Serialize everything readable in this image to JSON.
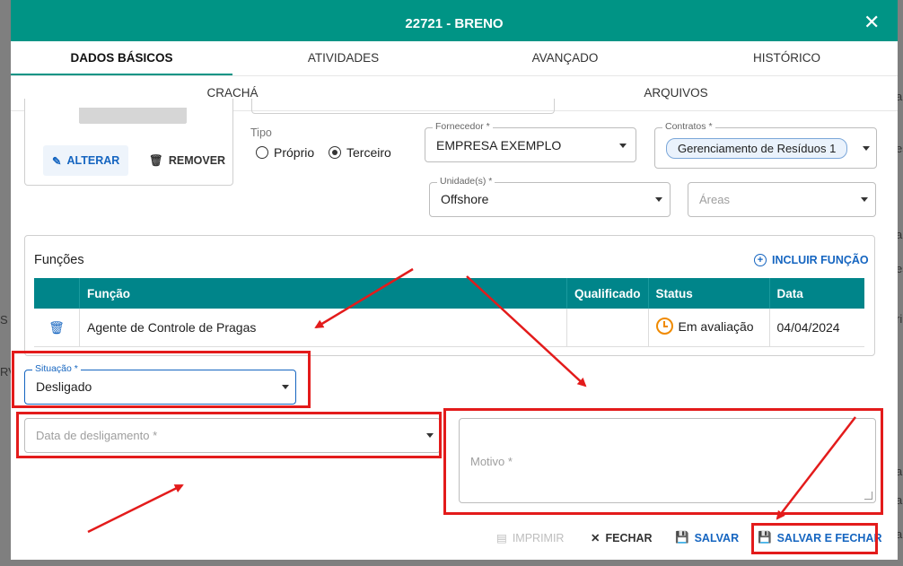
{
  "background_fragments": [
    "ali",
    "es",
    "ali",
    "es",
    "ri",
    "S C",
    "RV",
    "ali",
    "ali",
    "ali"
  ],
  "dialog": {
    "title": "22721 - BRENO",
    "close_icon": "close-icon"
  },
  "tabs_row1": [
    {
      "label": "DADOS BÁSICOS",
      "active": true
    },
    {
      "label": "ATIVIDADES",
      "active": false
    },
    {
      "label": "AVANÇADO",
      "active": false
    },
    {
      "label": "HISTÓRICO",
      "active": false
    }
  ],
  "tabs_row2": [
    {
      "label": "CRACHÁ"
    },
    {
      "label": "ARQUIVOS"
    }
  ],
  "photo": {
    "alterar_label": "ALTERAR",
    "remover_label": "REMOVER"
  },
  "tipo": {
    "label": "Tipo",
    "options": [
      "Próprio",
      "Terceiro"
    ],
    "selected": "Terceiro"
  },
  "fornecedor": {
    "label": "Fornecedor *",
    "value": "EMPRESA EXEMPLO"
  },
  "contratos": {
    "label": "Contratos *",
    "chip": "Gerenciamento de Resíduos 1"
  },
  "unidades": {
    "label": "Unidade(s) *",
    "value": "Offshore"
  },
  "areas": {
    "placeholder": "Áreas"
  },
  "funcoes": {
    "title": "Funções",
    "include_label": "INCLUIR FUNÇÃO",
    "columns": [
      "",
      "Função",
      "Qualificado",
      "Status",
      "Data"
    ],
    "rows": [
      {
        "funcao": "Agente de Controle de Pragas",
        "qualificado": "",
        "status": "Em avaliação",
        "data": "04/04/2024"
      }
    ]
  },
  "situacao": {
    "label": "Situação *",
    "value": "Desligado"
  },
  "data_desligamento": {
    "placeholder": "Data de desligamento *"
  },
  "motivo": {
    "placeholder": "Motivo *"
  },
  "footer": {
    "imprimir": "IMPRIMIR",
    "fechar": "FECHAR",
    "salvar": "SALVAR",
    "salvar_fechar": "SALVAR E FECHAR"
  },
  "colors": {
    "primary": "#009485",
    "table_header": "#00858a",
    "action_blue": "#1565c0",
    "annotation_red": "#e31b1b",
    "status_orange": "#f08a00"
  }
}
